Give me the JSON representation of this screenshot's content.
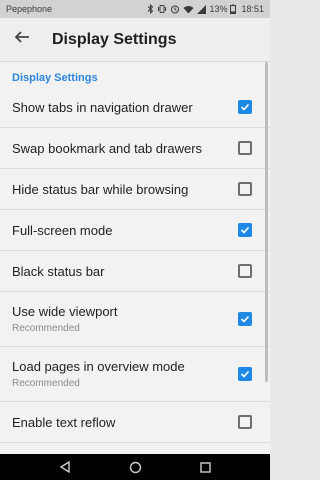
{
  "status_bar": {
    "carrier": "Pepephone",
    "battery": "13%",
    "time": "18:51",
    "icons": [
      "bluetooth-icon",
      "vibrate-icon",
      "alarm-icon",
      "wifi-icon",
      "signal-icon",
      "battery-icon"
    ]
  },
  "app_bar": {
    "back_icon": "arrow-back-icon",
    "title": "Display Settings"
  },
  "section": {
    "title": "Display Settings"
  },
  "preferences": [
    {
      "title": "Show tabs in navigation drawer",
      "summary": "",
      "checked": true
    },
    {
      "title": "Swap bookmark and tab drawers",
      "summary": "",
      "checked": false
    },
    {
      "title": "Hide status bar while browsing",
      "summary": "",
      "checked": false
    },
    {
      "title": "Full-screen mode",
      "summary": "",
      "checked": true
    },
    {
      "title": "Black status bar",
      "summary": "",
      "checked": false
    },
    {
      "title": "Use wide viewport",
      "summary": "Recommended",
      "checked": true
    },
    {
      "title": "Load pages in overview mode",
      "summary": "Recommended",
      "checked": true
    },
    {
      "title": "Enable text reflow",
      "summary": "",
      "checked": false
    }
  ],
  "nav_bar": {
    "icons": [
      "back-triangle-icon",
      "home-circle-icon",
      "recents-square-icon"
    ]
  },
  "colors": {
    "accent": "#1e88e5",
    "section_header": "#2e86de"
  }
}
